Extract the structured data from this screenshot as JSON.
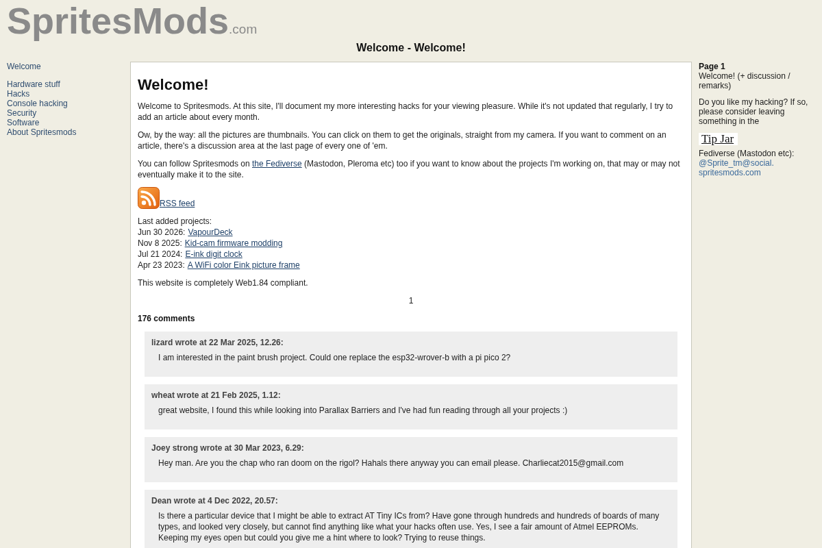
{
  "header": {
    "logo": "SpritesMods",
    "logo_suffix": ".com",
    "page_title": "Welcome - Welcome!"
  },
  "nav": {
    "groups": [
      {
        "items": [
          {
            "label": "Welcome"
          }
        ]
      },
      {
        "items": [
          {
            "label": "Hardware stuff"
          },
          {
            "label": "Hacks"
          },
          {
            "label": "Console hacking"
          },
          {
            "label": "Security"
          },
          {
            "label": "Software"
          },
          {
            "label": "About Spritesmods"
          }
        ]
      }
    ]
  },
  "article": {
    "title": "Welcome!",
    "paragraphs": [
      {
        "parts": [
          {
            "kind": "text",
            "text": "Welcome to Spritesmods. At this site, I'll document my more interesting hacks for your viewing pleasure. While it's not updated that regularly, I try to add an article about every month."
          }
        ]
      },
      {
        "parts": [
          {
            "kind": "text",
            "text": "Ow, by the way: all the pictures are thumbnails. You can click on them to get the originals, straight from my camera. If you want to comment on an article, there's a discussion area at the last page of every one of 'em."
          }
        ]
      },
      {
        "parts": [
          {
            "kind": "text",
            "text": "You can follow Spritesmods on "
          },
          {
            "kind": "link",
            "text": "the Fediverse"
          },
          {
            "kind": "text",
            "text": " (Mastodon, Pleroma etc) too if you want to know about the projects I'm working on, that may or may not eventually make it to the site."
          }
        ]
      }
    ],
    "rss": {
      "label": "RSS feed"
    },
    "projects": {
      "heading": "Last added projects:",
      "items": [
        {
          "date": "Jun 30 2026:",
          "title": "VapourDeck"
        },
        {
          "date": "Nov 8 2025:",
          "title": "Kid-cam firmware modding"
        },
        {
          "date": "Jul 21 2024:",
          "title": "E-ink digit clock"
        },
        {
          "date": "Apr 23 2023:",
          "title": "A WiFi color Eink picture frame"
        }
      ]
    },
    "note": "This website is completely Web1.84 compliant.",
    "pages": [
      "1"
    ]
  },
  "comments": {
    "count": "176 comments",
    "items": [
      {
        "author": "lizard wrote at 22 Mar 2025, 12.26:",
        "body": "I am interested in the paint brush project. Could one replace the esp32-wrover-b with a pi pico 2?"
      },
      {
        "author": "wheat wrote at 21 Feb 2025, 1.12:",
        "body": "great website, I found this while looking into Parallax Barriers and I've had fun reading through all your projects :)"
      },
      {
        "author": "Joey strong wrote at 30 Mar 2023, 6.29:",
        "body": "Hey man. Are you the chap who ran doom on the rigol? Hahals there anyway you can email please. Charliecat2015@gmail.com"
      },
      {
        "author": "Dean wrote at 4 Dec 2022, 20.57:",
        "body": "Is there a particular device that I might be able to extract AT Tiny ICs from? Have gone through hundreds and hundreds of boards of many types, and looked very closely, but cannot find anything like what your hacks often use. Yes, I see a fair amount of Atmel EEPROMs. Keeping my eyes open but could you give me a hint where to look? Trying to reuse things."
      }
    ]
  },
  "sidebar": {
    "page_label": "Page 1",
    "page_title": "Welcome! (+ discussion / remarks)",
    "tip_text": "Do you like my hacking? If so, please consider leaving something in the",
    "tip_jar": "Tip Jar",
    "fediverse_label": "Fediverse (Mastodon etc):",
    "fediverse_handle_lines": [
      "@Sprite_tm@social.",
      "spritesmods.com"
    ]
  }
}
